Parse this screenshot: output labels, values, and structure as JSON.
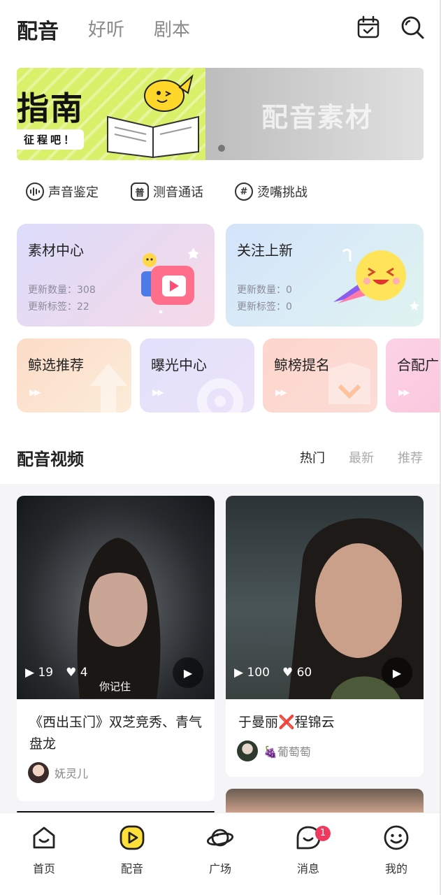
{
  "header": {
    "tabs": [
      "配音",
      "好听",
      "剧本"
    ],
    "active_tab": "配音"
  },
  "banner": {
    "left_title": "指南",
    "left_subtitle": "征程吧！",
    "right_title": "配音素材"
  },
  "quick_links": [
    {
      "label": "声音鉴定",
      "icon": "voice-wave-icon"
    },
    {
      "label": "测音通话",
      "icon": "普"
    },
    {
      "label": "烫嘴挑战",
      "icon": "#"
    }
  ],
  "big_cards": [
    {
      "title": "素材中心",
      "stat1_label": "更新数量：",
      "stat1_value": "308",
      "stat2_label": "更新标签：",
      "stat2_value": "22"
    },
    {
      "title": "关注上新",
      "stat1_label": "更新数量：",
      "stat1_value": "0",
      "stat2_label": "更新标签：",
      "stat2_value": "0"
    }
  ],
  "small_cards": [
    "鲸选推荐",
    "曝光中心",
    "鲸榜提名",
    "合配广"
  ],
  "section": {
    "title": "配音视频",
    "filters": [
      "热门",
      "最新",
      "推荐"
    ],
    "active_filter": "热门"
  },
  "videos": [
    {
      "plays": "19",
      "likes": "4",
      "caption": "你记住",
      "title": "《西出玉门》双芝竞秀、青气盘龙",
      "author": "妩灵儿"
    },
    {
      "plays": "100",
      "likes": "60",
      "caption": "",
      "title": "于曼丽❌程锦云",
      "author": "🍇葡萄萄"
    }
  ],
  "bottom_nav": [
    {
      "label": "首页",
      "icon": "home-icon"
    },
    {
      "label": "配音",
      "icon": "dubbing-icon"
    },
    {
      "label": "广场",
      "icon": "planet-icon"
    },
    {
      "label": "消息",
      "icon": "message-icon",
      "badge": "1"
    },
    {
      "label": "我的",
      "icon": "smile-icon"
    }
  ],
  "colors": {
    "accent_yellow": "#ffe03a",
    "badge_red": "#f0395f"
  }
}
